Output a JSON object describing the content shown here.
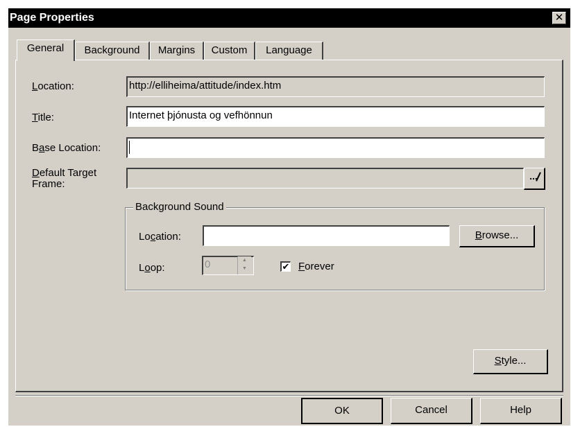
{
  "window": {
    "title": "Page Properties",
    "close_glyph": "✕"
  },
  "tabs": [
    {
      "label": "General",
      "active": true
    },
    {
      "label": "Background",
      "active": false
    },
    {
      "label": "Margins",
      "active": false
    },
    {
      "label": "Custom",
      "active": false
    },
    {
      "label": "Language",
      "active": false
    }
  ],
  "general": {
    "location": {
      "label_u": "L",
      "label_rest": "ocation:",
      "value": "http://elliheima/attitude/index.htm"
    },
    "title": {
      "label_u": "T",
      "label_rest": "itle:",
      "value": "Internet þjónusta og vefhönnun"
    },
    "base_location": {
      "label_pre": "B",
      "label_u": "a",
      "label_rest": "se Location:",
      "value": ""
    },
    "default_target_frame": {
      "label_u": "D",
      "label_rest1": "efault Target",
      "label_line2": "Frame:",
      "value": "",
      "browse_glyph": "..."
    }
  },
  "background_sound": {
    "legend": "Background Sound",
    "location": {
      "label_pre": "Lo",
      "label_u": "c",
      "label_rest": "ation:",
      "value": ""
    },
    "browse_button": {
      "label_u": "B",
      "label_rest": "rowse..."
    },
    "loop": {
      "label_pre": "L",
      "label_u": "o",
      "label_rest": "op:",
      "value": "0"
    },
    "forever": {
      "checked": true,
      "check_glyph": "✔",
      "label_u": "F",
      "label_rest": "orever"
    }
  },
  "style_button": {
    "label_u": "S",
    "label_rest": "tyle..."
  },
  "footer": {
    "ok": "OK",
    "cancel": "Cancel",
    "help": "Help"
  },
  "colors": {
    "dialog_bg": "#d4d0c8",
    "titlebar_bg": "#000000"
  }
}
